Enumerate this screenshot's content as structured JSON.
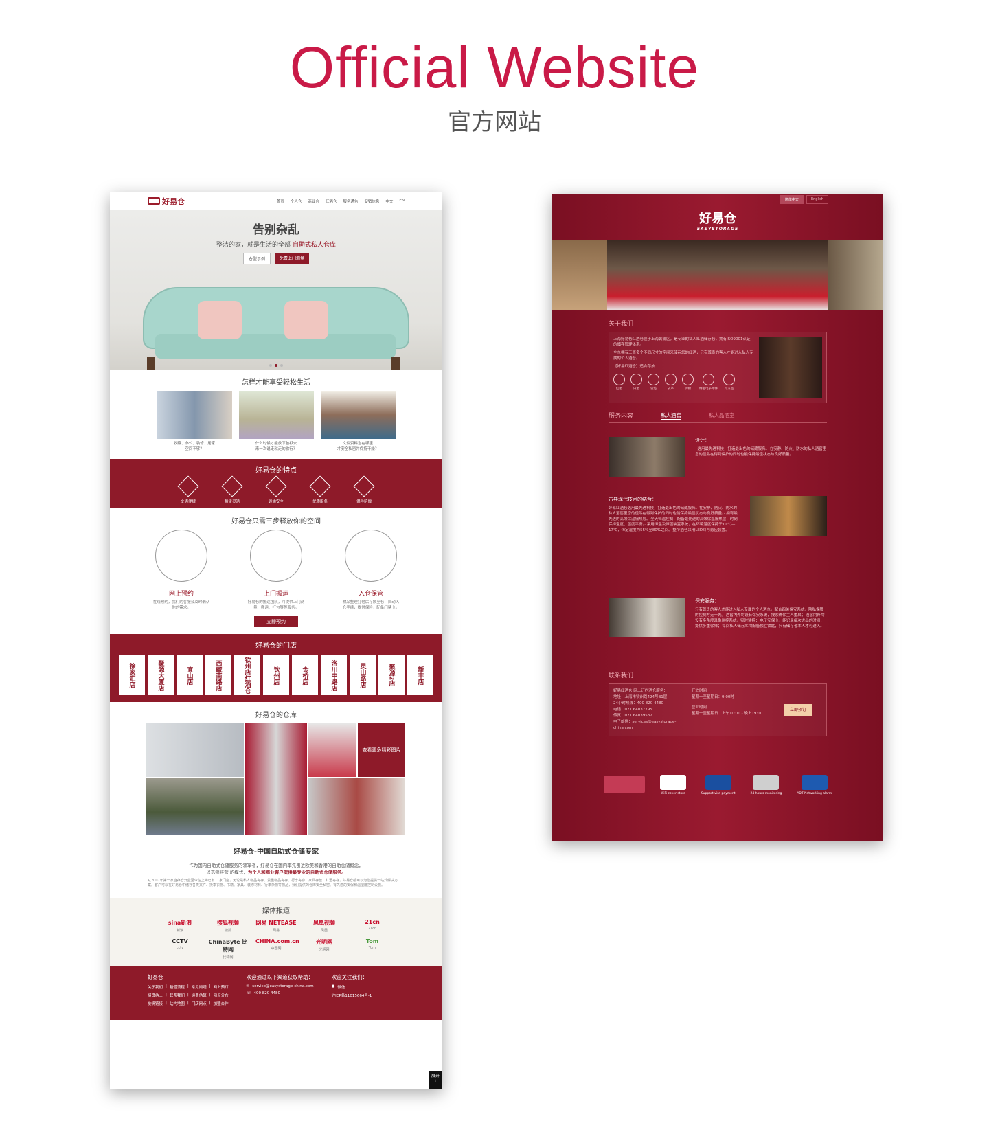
{
  "header": {
    "title": "Official Website",
    "subtitle": "官方网站"
  },
  "left": {
    "logo": "好易仓",
    "nav": [
      "首页",
      "个人仓",
      "商业仓",
      "红酒仓",
      "服务通告",
      "促销信息",
      "中文",
      "EN"
    ],
    "banner": {
      "title": "告别杂乱",
      "line_a": "整洁的家，就是生活的全部",
      "line_b": "自助式私人仓库",
      "btn_a": "仓型示例",
      "btn_b": "免费上门测量"
    },
    "section1": {
      "title": "怎样才能享受轻松生活",
      "cards": [
        {
          "cap1": "收藏、办公、装修、居家",
          "cap2": "空间不够？"
        },
        {
          "cap1": "什么时候才能放下包袱去",
          "cap2": "来一次说走就走的旅行？"
        },
        {
          "cap1": "文件资料当在哪里",
          "cap2": "才安全私密并保持干燥？"
        }
      ]
    },
    "features": {
      "title": "好易仓的特点",
      "items": [
        "交通便捷",
        "租赁灵活",
        "设施安全",
        "优质服务",
        "保险赔偿"
      ]
    },
    "steps": {
      "title": "好易仓只需三步释放你的空间",
      "items": [
        {
          "name": "网上预约",
          "desc": "在线预约，我们的客服会及时确认你的需求。"
        },
        {
          "name": "上门搬运",
          "desc": "好易仓的搬运团队，可提供上门测量、搬运、打包等等服务。"
        },
        {
          "name": "入仓保管",
          "desc": "物品整理打包后存放至仓，自动入仓手续，提供保险，配备门禁卡。"
        }
      ],
      "cta": "立即预约"
    },
    "stores": {
      "title": "好易仓的门店",
      "items": [
        "徐家汇店",
        "聚源大厦店",
        "宜山店",
        "西藏南路店",
        "钦州店红酒仓",
        "钦州店",
        "金桥店",
        "洛川中路店",
        "灵山路店",
        "聚源2店",
        "新丰店"
      ]
    },
    "warehouse": {
      "title": "好易仓的仓库",
      "more": "查看更多精彩图片"
    },
    "about": {
      "title": "好易仓-中国自助式仓储专家",
      "intro1": "作为国内自助式仓储服务的领军者，好易仓在国内率先引进欧美和香港的自助仓储概念，",
      "intro2": "以选锁经营 的模式，",
      "intro_bold": "为个人和商业客户提供最专业的自助式仓储服务。",
      "long": "从2007年第一家自存仓开业至今在上海已有11家门店，无论是私人物品寄存、贵重物品寄存、行李寄存、家具存放、红酒寄存，好易仓都可以为您提供一站式解决方案。客户可以在好易仓中储存各类文件、换季衣物、书籍、家具、装修材料、行李杂物等物品，我们提供的仓库安全私密、有先进的安保和温湿度控制设施。"
    },
    "media": {
      "title": "媒体报道",
      "items": [
        {
          "logo": "sina新浪",
          "cap": "新浪"
        },
        {
          "logo": "搜狐视频",
          "cap": "搜狐"
        },
        {
          "logo": "网易 NETEASE",
          "cap": "网易"
        },
        {
          "logo": "凤凰视频",
          "cap": "凤凰"
        },
        {
          "logo": "21cn",
          "cap": "21cn"
        },
        {
          "logo": "CCTV",
          "cap": "cctv"
        },
        {
          "logo": "ChinaByte 比特网",
          "cap": "比特网"
        },
        {
          "logo": "CHINA.com.cn",
          "cap": "中国网"
        },
        {
          "logo": "光明网",
          "cap": "光明网"
        },
        {
          "logo": "Tom",
          "cap": "Tom"
        }
      ]
    },
    "footer": {
      "col1_title": "好易仓",
      "col1_rows": [
        [
          "关于我们",
          "租借流程",
          "常见问题",
          "网上预订"
        ],
        [
          "招贤纳士",
          "联系我们",
          "运费估算",
          "网点分布"
        ],
        [
          "友情链接",
          "站内地图",
          "门店网点",
          "加盟合作"
        ]
      ],
      "col2_title": "欢迎通过以下渠道获取帮助：",
      "email": "service@easystorage-china.com",
      "phone": "400 820 4480",
      "col3_title": "欢迎关注我们：",
      "wechat": "微信",
      "icp": "沪ICP备11015664号-1"
    },
    "side_btn": "展开"
  },
  "right": {
    "lang_zh": "简体中文",
    "lang_en": "English",
    "logo": "好易仓",
    "logo_en": "EASYSTORAGE",
    "about": {
      "title": "关于我们",
      "p1": "上海好易仓红酒仓位于上海黄浦区，是专业的私人红酒储存仓，拥有ISO9001认证的储存管理体系。",
      "p2": "全仓拥有三百多个不同尺寸的空间来储存您的红酒，只有尊贵的客人才能进入私人专属的个人酒仓。",
      "suit": "【好易红酒仓】适合存放：",
      "icons": [
        "红酒",
        "白酒",
        "雪茄",
        "皮革",
        "药物",
        "精密电子零件",
        "冷冻品"
      ]
    },
    "service": {
      "title": "服务内容",
      "tab1": "私人酒窖",
      "tab2": "私人品酒室",
      "s1_title": "设计：",
      "s1_text": "· 选用最先进科技，打造最出色的储藏服务。· 在安静、防火、防水的私人酒窖里您的佳品在得到保护的同时也能保持最佳状态与良好质量。",
      "s2_title": "古典现代技术的结合：",
      "s2_text": "好易红酒仓选用最先进科技，打造最出色的储藏服务。在安静、防火、防水的私人酒窖里您的佳品在得到保护的同时也能保持最佳状态与良好质量。· 拥有最先进的高效保温隔热层。· 全天恒温控制，配备最先进的高效保温隔热层，时刻保持温度、湿度平衡。· 采用恒温及恒湿装置系统，在环境温度保持于11℃—17℃，恒定湿度为55%至80%之间。· 整个酒仓采用LED灯与感应装置。",
      "s3_title": "保安服务：",
      "s3_text": "只有尊贵的客人才能进入私人专属的个人酒仓。配合四关保安系统，隐私保障的控制方无一失。· 酒窖内外均设有保安系统，搜索确保主人重启；· 酒窖内外均设有多角度录像监控系统，实时监控；· 电子安保卡，能记录每次进出的时间，提供多重保障；· 每间私人储存库均配备独立锁匙，只有储存者本人才可进入。"
    },
    "contact": {
      "title": "联系我们",
      "c1": "好易红酒仓 网上订约酒仓服务：",
      "c2": "地址：上海市钦州路424号B1层",
      "c3": "24小时热线：400 820 4480",
      "c4": "电话：021 64037795",
      "c5": "传真：021 64039532",
      "c6": "电子邮件：services@easystorage-china.com",
      "hours_title": "开放时间",
      "hours_1": "星期一至星期日：9:00时",
      "hours_title2": "营业时间",
      "hours_2": "星期一至星期日：上午10:00 - 晚上19:00",
      "btn": "立即预订"
    },
    "footer": [
      {
        "label": "",
        "icon": "logo"
      },
      {
        "label": "WiFi cover store",
        "icon": "wifi"
      },
      {
        "label": "Support visa payment",
        "icon": "visa"
      },
      {
        "label": "24 hours monitoring",
        "icon": "camera"
      },
      {
        "label": "ADT Networking alarm",
        "icon": "adt"
      }
    ]
  },
  "colors": {
    "brand_red": "#8e1a29",
    "title_red": "#c91a47",
    "wine_red": "#8a1428"
  }
}
